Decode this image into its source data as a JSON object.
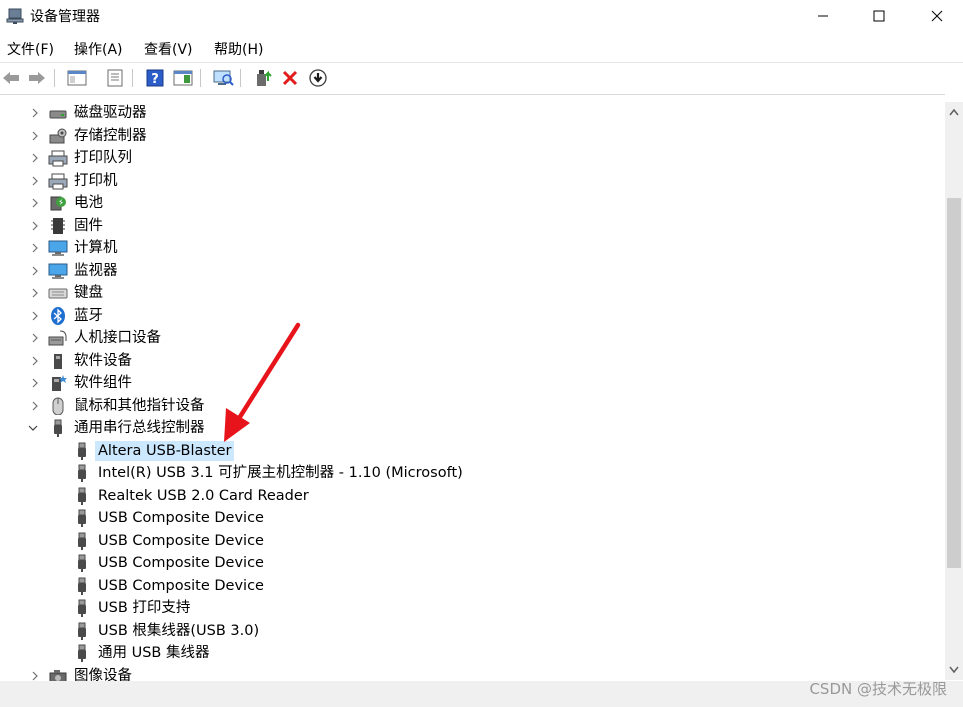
{
  "window": {
    "title": "设备管理器",
    "icon": "device-manager-icon"
  },
  "menu": [
    {
      "label": "文件(F)"
    },
    {
      "label": "操作(A)"
    },
    {
      "label": "查看(V)"
    },
    {
      "label": "帮助(H)"
    }
  ],
  "toolbar": [
    {
      "icon": "back-arrow-icon"
    },
    {
      "icon": "forward-arrow-icon"
    },
    {
      "icon": "show-hide-tree-icon"
    },
    {
      "icon": "properties-icon"
    },
    {
      "icon": "help-icon"
    },
    {
      "icon": "action-pane-icon"
    },
    {
      "icon": "scan-hardware-icon"
    },
    {
      "icon": "update-driver-icon"
    },
    {
      "icon": "uninstall-device-icon"
    },
    {
      "icon": "download-driver-icon"
    }
  ],
  "tree": {
    "categories": [
      {
        "label": "磁盘驱动器",
        "icon": "disk-drive-icon"
      },
      {
        "label": "存储控制器",
        "icon": "storage-controller-icon"
      },
      {
        "label": "打印队列",
        "icon": "print-queue-icon"
      },
      {
        "label": "打印机",
        "icon": "printer-icon"
      },
      {
        "label": "电池",
        "icon": "battery-icon"
      },
      {
        "label": "固件",
        "icon": "firmware-icon"
      },
      {
        "label": "计算机",
        "icon": "computer-icon"
      },
      {
        "label": "监视器",
        "icon": "monitor-icon"
      },
      {
        "label": "键盘",
        "icon": "keyboard-icon"
      },
      {
        "label": "蓝牙",
        "icon": "bluetooth-icon"
      },
      {
        "label": "人机接口设备",
        "icon": "hid-icon"
      },
      {
        "label": "软件设备",
        "icon": "software-device-icon"
      },
      {
        "label": "软件组件",
        "icon": "software-component-icon"
      },
      {
        "label": "鼠标和其他指针设备",
        "icon": "mouse-icon"
      },
      {
        "label": "通用串行总线控制器",
        "icon": "usb-plug-icon",
        "expanded": true
      }
    ],
    "usb_children": [
      {
        "label": "Altera USB-Blaster",
        "selected": true
      },
      {
        "label": "Intel(R) USB 3.1 可扩展主机控制器 - 1.10 (Microsoft)"
      },
      {
        "label": "Realtek USB 2.0 Card Reader"
      },
      {
        "label": "USB Composite Device"
      },
      {
        "label": "USB Composite Device"
      },
      {
        "label": "USB Composite Device"
      },
      {
        "label": "USB Composite Device"
      },
      {
        "label": "USB 打印支持"
      },
      {
        "label": "USB 根集线器(USB 3.0)"
      },
      {
        "label": "通用 USB 集线器"
      }
    ],
    "after": [
      {
        "label": "图像设备",
        "icon": "camera-icon"
      }
    ]
  },
  "watermark": "CSDN @技术无极限",
  "colors": {
    "selection": "#cce8ff",
    "annotation_arrow": "#e8141c"
  }
}
